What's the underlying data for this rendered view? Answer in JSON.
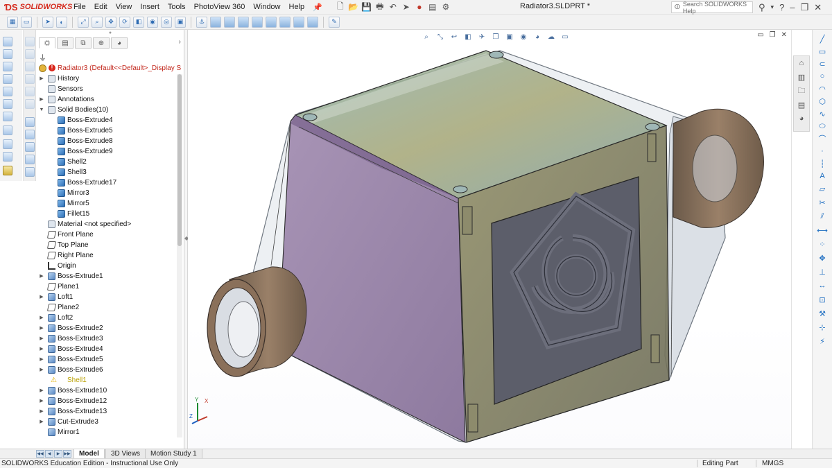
{
  "app": {
    "brand": "SOLIDWORKS",
    "document_title": "Radiator3.SLDPRT *",
    "search_placeholder": "Search SOLIDWORKS Help"
  },
  "menu": [
    "File",
    "Edit",
    "View",
    "Insert",
    "Tools",
    "PhotoView 360",
    "Window",
    "Help"
  ],
  "feature_tree": {
    "root": "Radiator3  (Default<<Default>_Display S",
    "items": [
      {
        "label": "History",
        "icon": "history-icon",
        "expander": true,
        "level": 1
      },
      {
        "label": "Sensors",
        "icon": "sensors-icon",
        "expander": false,
        "level": 1
      },
      {
        "label": "Annotations",
        "icon": "annotations-icon",
        "expander": true,
        "level": 1
      },
      {
        "label": "Solid Bodies(10)",
        "icon": "solid-bodies-folder-icon",
        "expander": true,
        "expanded": true,
        "level": 1
      },
      {
        "label": "Boss-Extrude4",
        "icon": "solid-body-icon",
        "level": 2
      },
      {
        "label": "Boss-Extrude5",
        "icon": "solid-body-icon",
        "level": 2
      },
      {
        "label": "Boss-Extrude8",
        "icon": "solid-body-icon",
        "level": 2
      },
      {
        "label": "Boss-Extrude9",
        "icon": "solid-body-icon",
        "level": 2
      },
      {
        "label": "Shell2",
        "icon": "solid-body-icon",
        "level": 2
      },
      {
        "label": "Shell3",
        "icon": "solid-body-icon",
        "level": 2
      },
      {
        "label": "Boss-Extrude17",
        "icon": "solid-body-icon",
        "level": 2
      },
      {
        "label": "Mirror3",
        "icon": "solid-body-icon",
        "level": 2
      },
      {
        "label": "Mirror5",
        "icon": "solid-body-icon",
        "level": 2
      },
      {
        "label": "Fillet15",
        "icon": "solid-body-icon",
        "level": 2
      },
      {
        "label": "Material <not specified>",
        "icon": "material-icon",
        "expander": false,
        "level": 1
      },
      {
        "label": "Front Plane",
        "icon": "plane-icon",
        "expander": false,
        "level": 1
      },
      {
        "label": "Top Plane",
        "icon": "plane-icon",
        "expander": false,
        "level": 1
      },
      {
        "label": "Right Plane",
        "icon": "plane-icon",
        "expander": false,
        "level": 1
      },
      {
        "label": "Origin",
        "icon": "origin-icon",
        "expander": false,
        "level": 1
      },
      {
        "label": "Boss-Extrude1",
        "icon": "boss-extrude-icon",
        "expander": true,
        "level": 1
      },
      {
        "label": "Plane1",
        "icon": "plane-icon",
        "expander": false,
        "level": 1
      },
      {
        "label": "Loft1",
        "icon": "loft-icon",
        "expander": true,
        "level": 1
      },
      {
        "label": "Plane2",
        "icon": "plane-icon",
        "expander": false,
        "level": 1
      },
      {
        "label": "Loft2",
        "icon": "loft-icon",
        "expander": true,
        "level": 1
      },
      {
        "label": "Boss-Extrude2",
        "icon": "boss-extrude-icon",
        "expander": true,
        "level": 1
      },
      {
        "label": "Boss-Extrude3",
        "icon": "boss-extrude-icon",
        "expander": true,
        "level": 1
      },
      {
        "label": "Boss-Extrude4",
        "icon": "boss-extrude-icon",
        "expander": true,
        "level": 1
      },
      {
        "label": "Boss-Extrude5",
        "icon": "boss-extrude-icon",
        "expander": true,
        "level": 1
      },
      {
        "label": "Boss-Extrude6",
        "icon": "boss-extrude-icon",
        "expander": true,
        "level": 1
      },
      {
        "label": "Shell1",
        "icon": "warning-icon",
        "expander": false,
        "level": 1,
        "warning": true
      },
      {
        "label": "Boss-Extrude10",
        "icon": "boss-extrude-icon",
        "expander": true,
        "level": 1
      },
      {
        "label": "Boss-Extrude12",
        "icon": "boss-extrude-icon",
        "expander": true,
        "level": 1
      },
      {
        "label": "Boss-Extrude13",
        "icon": "boss-extrude-icon",
        "expander": true,
        "level": 1
      },
      {
        "label": "Cut-Extrude3",
        "icon": "cut-extrude-icon",
        "expander": true,
        "level": 1
      },
      {
        "label": "Mirror1",
        "icon": "mirror-icon",
        "expander": false,
        "level": 1
      }
    ]
  },
  "bottom_tabs": [
    "Model",
    "3D Views",
    "Motion Study 1"
  ],
  "status": {
    "edition": "SOLIDWORKS Education Edition - Instructional Use Only",
    "mode": "Editing Part",
    "units": "MMGS"
  },
  "colors": {
    "brand_red": "#d52b1e",
    "warning_text": "#b9a000",
    "pipe_brown": "#8a705a",
    "side_purple": "#8b6f99",
    "front_olive": "#7b7b5a",
    "top_teal": "#7fa3a3",
    "accent_blue": "#1c6fc7"
  }
}
